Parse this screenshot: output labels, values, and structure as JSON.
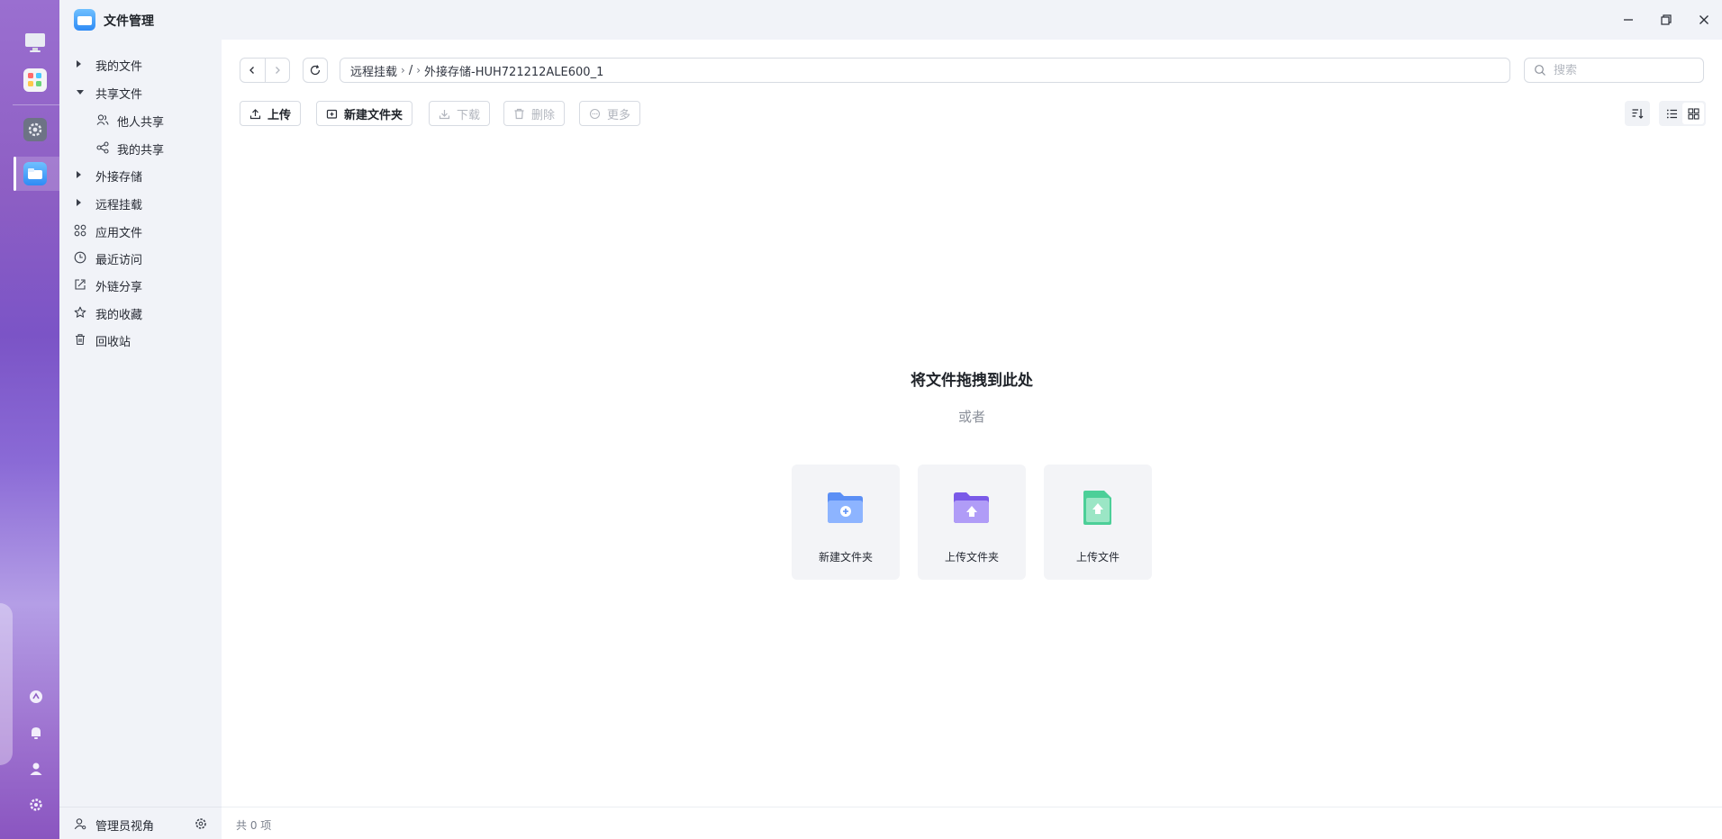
{
  "app": {
    "title": "文件管理"
  },
  "sidebar": {
    "items": [
      {
        "label": "我的文件"
      },
      {
        "label": "共享文件"
      },
      {
        "label": "他人共享"
      },
      {
        "label": "我的共享"
      },
      {
        "label": "外接存储"
      },
      {
        "label": "远程挂载"
      },
      {
        "label": "应用文件"
      },
      {
        "label": "最近访问"
      },
      {
        "label": "外链分享"
      },
      {
        "label": "我的收藏"
      },
      {
        "label": "回收站"
      }
    ],
    "footer": {
      "label": "管理员视角"
    }
  },
  "path": {
    "segments": [
      "远程挂载",
      "/",
      "外接存储-HUH721212ALE600_1"
    ],
    "separator": "›"
  },
  "search": {
    "placeholder": "搜索",
    "value": ""
  },
  "toolbar": {
    "upload": "上传",
    "new_folder": "新建文件夹",
    "download": "下载",
    "delete": "删除",
    "more": "更多"
  },
  "empty": {
    "title": "将文件拖拽到此处",
    "or": "或者",
    "cards": [
      {
        "label": "新建文件夹",
        "icon": "new-folder-icon",
        "color": "#5b8ff5"
      },
      {
        "label": "上传文件夹",
        "icon": "upload-folder-icon",
        "color": "#8a6cf0"
      },
      {
        "label": "上传文件",
        "icon": "upload-file-icon",
        "color": "#4ccf98"
      }
    ]
  },
  "status": {
    "count_text": "共 0 项"
  },
  "colors": {
    "accent": "#2f8bf5",
    "sidebar_bg": "#f1f3f8",
    "dock_purple": "#8e5fc4"
  }
}
